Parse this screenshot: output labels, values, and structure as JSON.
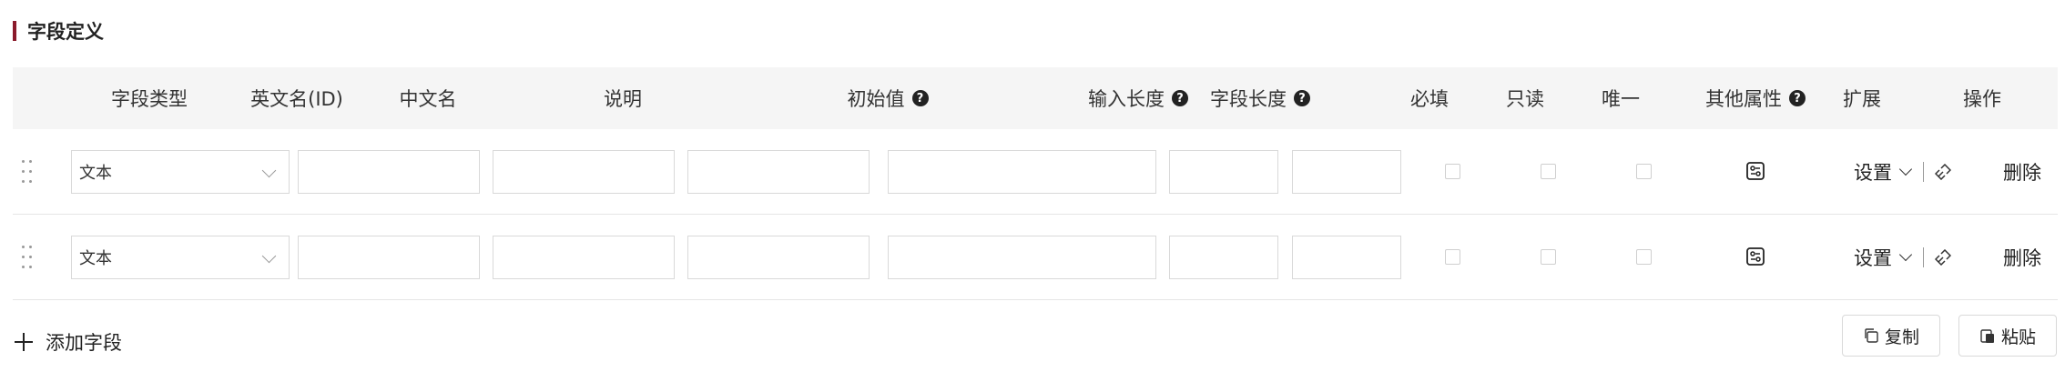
{
  "section": {
    "title": "字段定义",
    "accent_color": "#8b1a2b"
  },
  "columns": [
    {
      "key": "type",
      "label": "字段类型",
      "help": false
    },
    {
      "key": "en_name",
      "label": "英文名(ID)",
      "help": false
    },
    {
      "key": "cn_name",
      "label": "中文名",
      "help": false
    },
    {
      "key": "desc",
      "label": "说明",
      "help": false
    },
    {
      "key": "initial",
      "label": "初始值",
      "help": true
    },
    {
      "key": "input_len",
      "label": "输入长度",
      "help": true
    },
    {
      "key": "field_len",
      "label": "字段长度",
      "help": true
    },
    {
      "key": "required",
      "label": "必填",
      "help": false
    },
    {
      "key": "readonly",
      "label": "只读",
      "help": false
    },
    {
      "key": "unique",
      "label": "唯一",
      "help": false
    },
    {
      "key": "other_attrs",
      "label": "其他属性",
      "help": true
    },
    {
      "key": "extension",
      "label": "扩展",
      "help": false
    },
    {
      "key": "actions",
      "label": "操作",
      "help": false
    }
  ],
  "help_glyph": "?",
  "rows": [
    {
      "type": "文本",
      "en_name": "",
      "cn_name": "",
      "desc": "",
      "initial": "",
      "input_len": "",
      "field_len": "",
      "required": false,
      "readonly": false,
      "unique": false,
      "ext_label": "设置",
      "delete_label": "删除"
    },
    {
      "type": "文本",
      "en_name": "",
      "cn_name": "",
      "desc": "",
      "initial": "",
      "input_len": "",
      "field_len": "",
      "required": false,
      "readonly": false,
      "unique": false,
      "ext_label": "设置",
      "delete_label": "删除"
    }
  ],
  "footer": {
    "add_field_label": "添加字段",
    "copy_label": "复制",
    "paste_label": "粘贴"
  },
  "icons": {
    "drag": "drag-handle-icon",
    "other_attrs": "attributes-settings-icon",
    "ext_extra": "link-icon",
    "add": "plus-icon",
    "copy": "copy-icon",
    "paste": "paste-icon"
  }
}
